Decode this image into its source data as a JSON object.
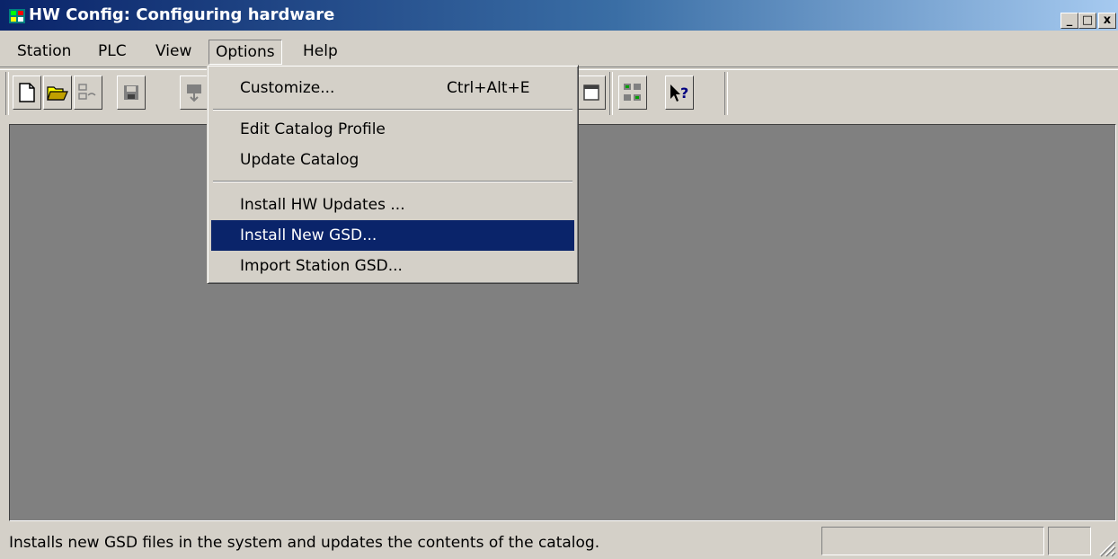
{
  "window": {
    "title": "HW Config: Configuring hardware",
    "controls": {
      "minimize": "_",
      "restore": "□",
      "close": "x"
    }
  },
  "menubar": {
    "items": [
      {
        "label": "Station"
      },
      {
        "label": "PLC"
      },
      {
        "label": "View"
      },
      {
        "label": "Options",
        "open": true
      },
      {
        "label": "Help"
      }
    ]
  },
  "toolbar": {
    "icons": [
      "new-icon",
      "open-folder-icon",
      "station-icon",
      "save-icon",
      "download-icon",
      "window-icon",
      "network-icon",
      "whats-this-icon"
    ]
  },
  "options_menu": {
    "items": [
      {
        "label": "Customize...",
        "shortcut": "Ctrl+Alt+E"
      },
      {
        "label": "Edit Catalog Profile",
        "shortcut": ""
      },
      {
        "label": "Update Catalog",
        "shortcut": ""
      },
      {
        "label": "Install HW Updates ...",
        "shortcut": ""
      },
      {
        "label": "Install New GSD...",
        "shortcut": "",
        "highlighted": true
      },
      {
        "label": "Import Station GSD...",
        "shortcut": ""
      }
    ]
  },
  "statusbar": {
    "text": "Installs new GSD files in the system and updates the contents of the catalog."
  },
  "colors": {
    "face": "#d4d0c8",
    "highlight": "#0a246a",
    "workspace": "#808080"
  }
}
